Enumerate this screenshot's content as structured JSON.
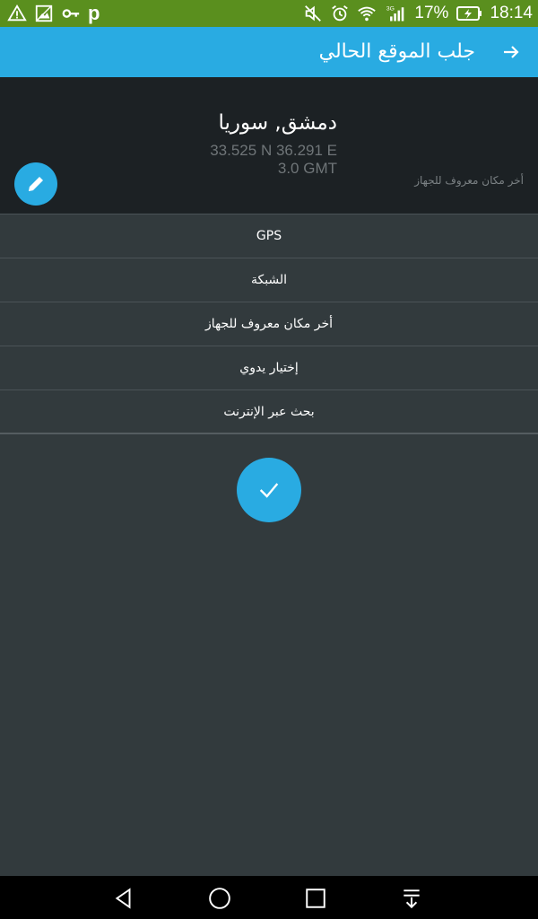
{
  "status_bar": {
    "left_icons": [
      "warning-icon",
      "image-icon",
      "key-icon",
      "parking-icon"
    ],
    "parking_label": "p",
    "network_type": "3G",
    "battery": "17%",
    "time": "18:14"
  },
  "toolbar": {
    "title": "جلب الموقع الحالي",
    "back_icon": "arrow-right-icon"
  },
  "location": {
    "city": "دمشق, سوريا",
    "coordinates": "33.525 N 36.291 E",
    "timezone": "3.0 GMT",
    "source": "أخر مكان معروف للجهاز"
  },
  "options": [
    {
      "label": "GPS"
    },
    {
      "label": "الشبكة"
    },
    {
      "label": "أخر مكان معروف للجهاز"
    },
    {
      "label": "إختيار يدوي"
    },
    {
      "label": "بحث عبر الإنترنت"
    }
  ],
  "colors": {
    "status_bar": "#5a8f1e",
    "accent": "#29abe2",
    "header_bg": "#1c2124",
    "body_bg": "#323a3d"
  }
}
